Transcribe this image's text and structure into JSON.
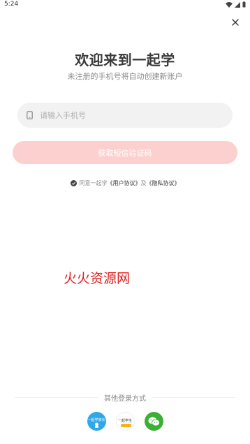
{
  "status_bar": {
    "time": "5:24"
  },
  "header": {
    "close_icon": "close-icon"
  },
  "welcome": {
    "title": "欢迎来到一起学",
    "subtitle": "未注册的手机号将自动创建新账户"
  },
  "phone": {
    "placeholder": "请输入手机号",
    "value": "",
    "icon": "phone-icon"
  },
  "actions": {
    "get_code_label": "获取短信验证码"
  },
  "agreement": {
    "prefix": "同意一起学",
    "user_agreement": "《用户协议》",
    "and": "及",
    "privacy_policy": "《隐私协议》"
  },
  "watermark": "火火资源网",
  "other_login": {
    "label": "其他登录方式",
    "options": [
      {
        "name": "一起学家长",
        "icon": "parent-app-icon"
      },
      {
        "name": "一起学生",
        "icon": "student-app-icon"
      },
      {
        "name": "微信",
        "icon": "wechat-icon"
      }
    ]
  },
  "colors": {
    "button_bg": "#fcd0cf",
    "watermark": "#e21d1d",
    "wechat": "#3cb034",
    "parent_app": "#2fa8e8"
  }
}
